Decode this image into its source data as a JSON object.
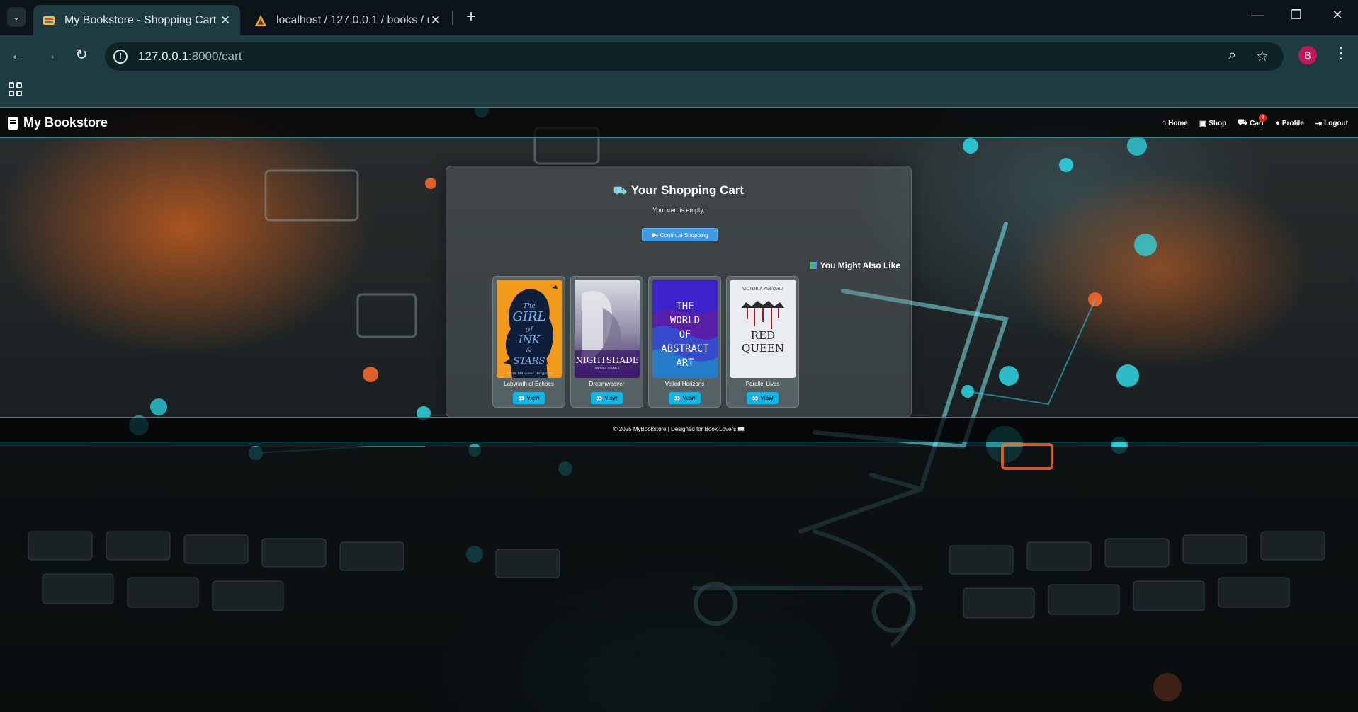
{
  "browser": {
    "tabs": [
      {
        "title": "My Bookstore - Shopping Cart",
        "active": true
      },
      {
        "title": "localhost / 127.0.0.1 / books / u",
        "active": false
      }
    ],
    "url_host": "127.0.0.1",
    "url_path": ":8000/cart",
    "profile_initial": "B"
  },
  "site": {
    "brand": "My Bookstore",
    "nav": [
      {
        "label": "Home",
        "icon": "home-icon"
      },
      {
        "label": "Shop",
        "icon": "store-icon"
      },
      {
        "label": "Cart",
        "icon": "cart-icon",
        "badge": "0"
      },
      {
        "label": "Profile",
        "icon": "user-icon"
      },
      {
        "label": "Logout",
        "icon": "logout-icon"
      }
    ]
  },
  "cart": {
    "title": "Your Shopping Cart",
    "empty_message": "Your cart is empty.",
    "continue_label": "Continue Shopping",
    "recommend_title": "You Might Also Like"
  },
  "books": [
    {
      "title": "Labyrinth of Echoes",
      "cover_text": "The GIRL of INK & STARS",
      "view_label": "View"
    },
    {
      "title": "Dreamweaver",
      "cover_text": "NIGHTSHADE",
      "view_label": "View"
    },
    {
      "title": "Veiled Horizons",
      "cover_text": "THE WORLD OF ABSTRACT ART",
      "view_label": "View"
    },
    {
      "title": "Parallel Lives",
      "cover_text": "RED QUEEN",
      "cover_author": "VICTORIA AVEYARD",
      "view_label": "View"
    }
  ],
  "footer": {
    "text": "© 2025 MyBookstore | Designed for Book Lovers"
  },
  "colors": {
    "accent": "#10b5e6",
    "button": "#3d9ae6",
    "badge": "#e52222"
  }
}
